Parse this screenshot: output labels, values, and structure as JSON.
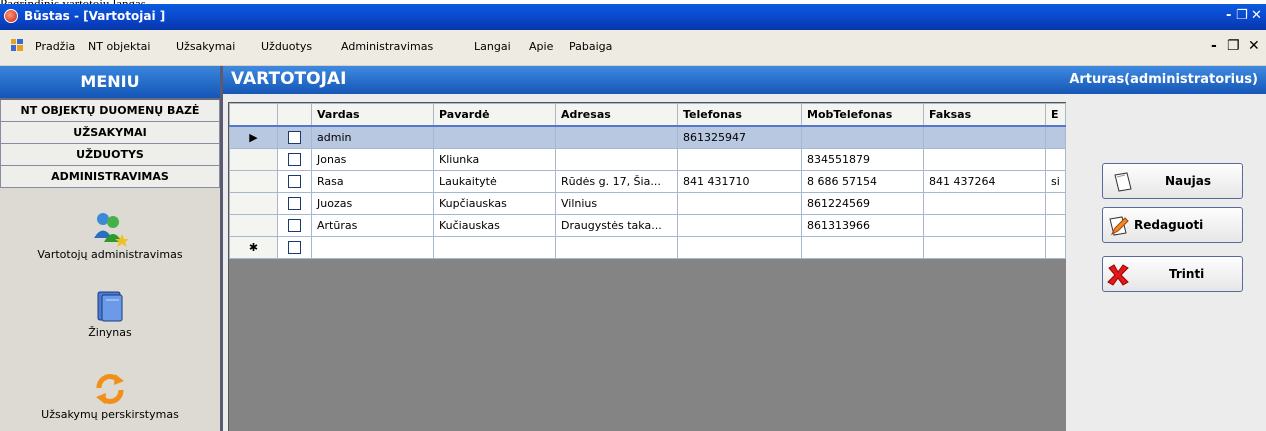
{
  "caption": "Pagrindinis vartotoju langas",
  "window": {
    "title": "Būstas - [Vartotojai ]",
    "controls": [
      "-",
      "♂",
      "✕"
    ]
  },
  "menubar": {
    "items": [
      "Pradžia",
      "NT objektai",
      "Užsakymai",
      "Užduotys",
      "Administravimas",
      "Langai",
      "Apie",
      "Pabaiga"
    ],
    "mdi_controls": [
      "-",
      "♂",
      "✕"
    ]
  },
  "leftpanel": {
    "header": "MENIU",
    "sections": [
      "NT OBJEKTŲ DUOMENŲ BAZĖ",
      "UŽSAKYMAI",
      "UŽDUOTYS",
      "ADMINISTRAVIMAS"
    ],
    "launchers": [
      {
        "label": "Vartotojų administravimas",
        "icon": "users-admin-icon"
      },
      {
        "label": "Žinynas",
        "icon": "books-icon"
      },
      {
        "label": "Užsakymų perskirstymas",
        "icon": "refresh-arrows-icon"
      }
    ]
  },
  "header": {
    "title": "VARTOTOJAI",
    "user": "Arturas(administratorius)"
  },
  "grid": {
    "columns": [
      "",
      "Vardas",
      "Pavardė",
      "Adresas",
      "Telefonas",
      "MobTelefonas",
      "Faksas",
      "E"
    ],
    "rows": [
      {
        "indicator": "▶",
        "vardas": "admin",
        "pavarde": "",
        "adresas": "",
        "telefonas": "861325947",
        "mob": "",
        "faksas": "",
        "e": ""
      },
      {
        "indicator": "",
        "vardas": "Jonas",
        "pavarde": "Kliunka",
        "adresas": "",
        "telefonas": "",
        "mob": "834551879",
        "faksas": "",
        "e": ""
      },
      {
        "indicator": "",
        "vardas": "Rasa",
        "pavarde": "Laukaitytė",
        "adresas": "Rūdės g. 17, Šia...",
        "telefonas": "841 431710",
        "mob": "8 686 57154",
        "faksas": "841 437264",
        "e": "si"
      },
      {
        "indicator": "",
        "vardas": "Juozas",
        "pavarde": "Kupčiauskas",
        "adresas": "Vilnius",
        "telefonas": "",
        "mob": "861224569",
        "faksas": "",
        "e": ""
      },
      {
        "indicator": "",
        "vardas": "Artūras",
        "pavarde": "Kučiauskas",
        "adresas": "Draugystės taka...",
        "telefonas": "",
        "mob": "861313966",
        "faksas": "",
        "e": ""
      },
      {
        "indicator": "✱",
        "vardas": "",
        "pavarde": "",
        "adresas": "",
        "telefonas": "",
        "mob": "",
        "faksas": "",
        "e": ""
      }
    ]
  },
  "actions": {
    "new": "Naujas",
    "edit": "Redaguoti",
    "delete": "Trinti"
  }
}
